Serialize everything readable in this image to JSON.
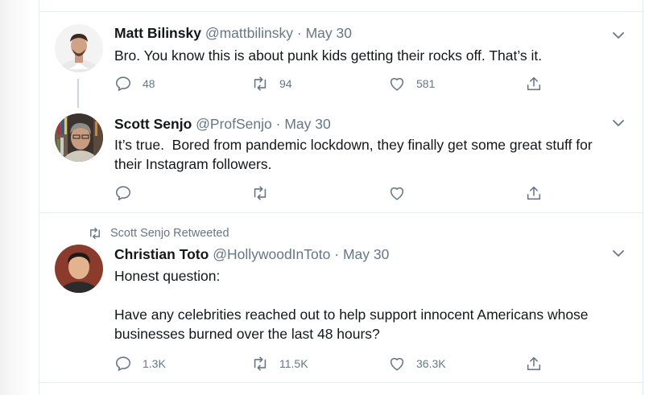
{
  "tweets": [
    {
      "name": "Matt Bilinsky",
      "handle": "@mattbilinsky",
      "date": "May 30",
      "text": "Bro. You know this is about punk kids getting their rocks off. That’s it.",
      "replies": "48",
      "retweets": "94",
      "likes": "581"
    },
    {
      "name": "Scott Senjo",
      "handle": "@ProfSenjo",
      "date": "May 30",
      "text": "It’s true.  Bored from pandemic lockdown, they finally get some great stuff for their Instagram followers.",
      "replies": "",
      "retweets": "",
      "likes": ""
    },
    {
      "retweeted_by": "Scott Senjo Retweeted",
      "name": "Christian Toto",
      "handle": "@HollywoodInToto",
      "date": "May 30",
      "text": "Honest question:\n\nHave any celebrities reached out to help support innocent Americans whose businesses burned over the last 48 hours?",
      "replies": "1.3K",
      "retweets": "11.5K",
      "likes": "36.3K"
    }
  ],
  "separator": "·",
  "colors": {
    "text": "#14171a",
    "secondary": "#657786",
    "border": "#e6ecf0",
    "thread_line": "#ccd6dd"
  },
  "icons": {
    "reply": "reply-icon",
    "retweet": "retweet-icon",
    "like": "heart-icon",
    "share": "share-icon",
    "caret": "chevron-down-icon"
  }
}
